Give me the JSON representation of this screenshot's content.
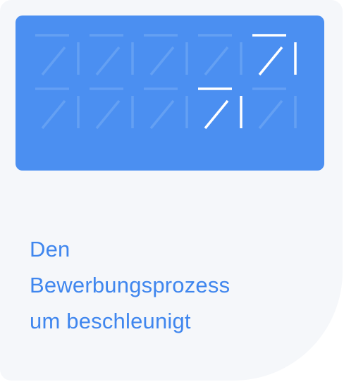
{
  "card": {
    "headline_lines": [
      "Den",
      "Bewerbungsprozess",
      "um beschleunigt"
    ]
  },
  "colors": {
    "card_background": "#f5f7fa",
    "banner_background": "#4b8ff1",
    "glyph_faded": "#7aaef6",
    "glyph_highlight": "#ffffff",
    "headline_text": "#3f86ee"
  },
  "banner": {
    "glyph_grid": {
      "rows": 2,
      "columns": 5,
      "highlighted_cells": [
        [
          0,
          4
        ],
        [
          1,
          3
        ]
      ]
    }
  }
}
